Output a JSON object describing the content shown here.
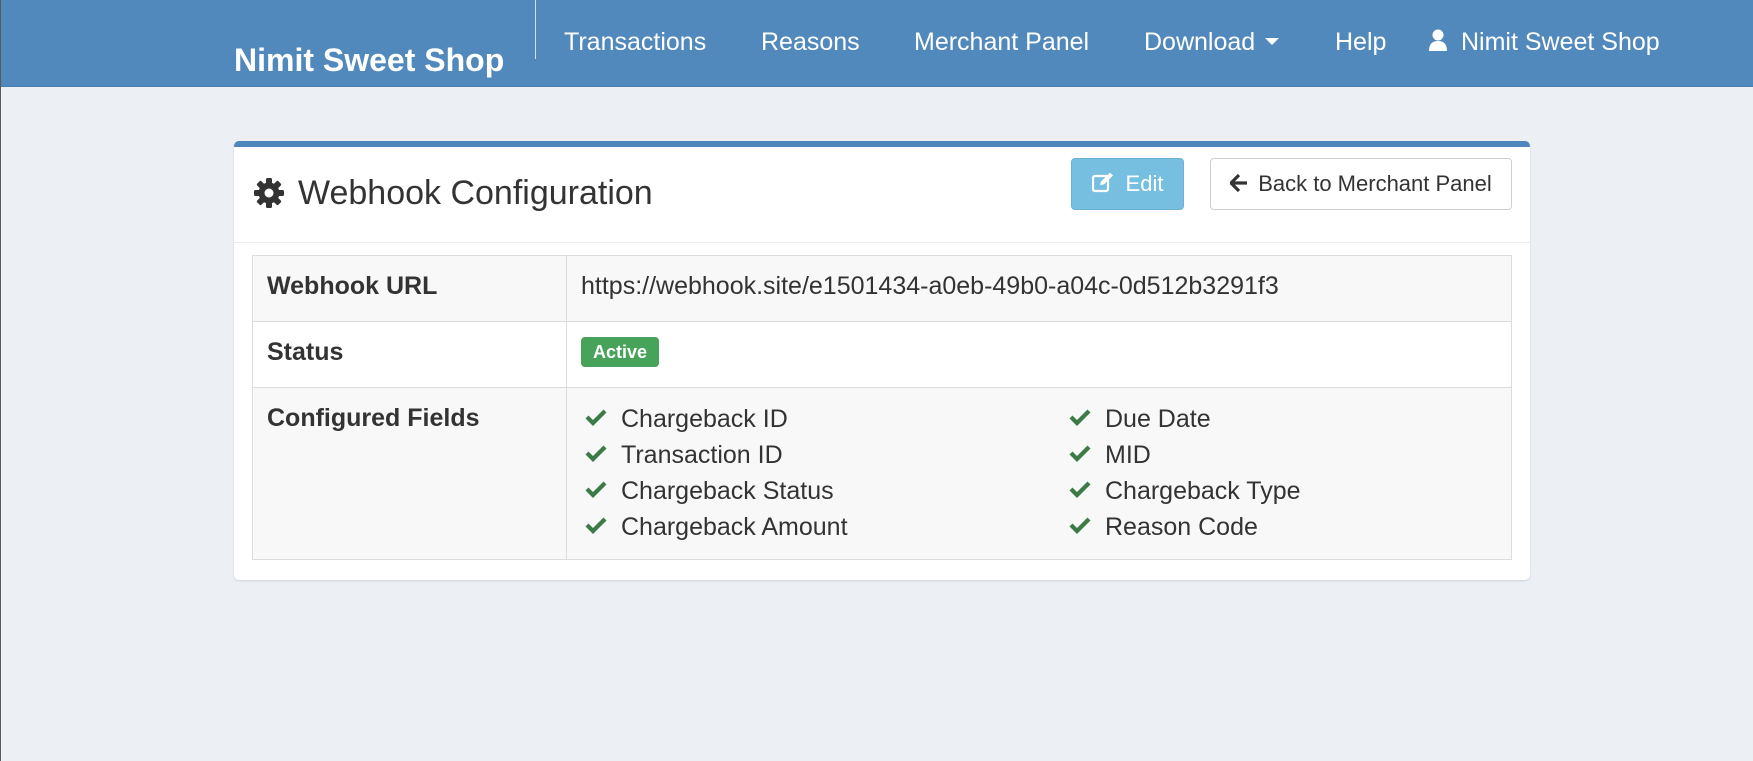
{
  "navbar": {
    "brand": "Nimit Sweet Shop",
    "items": [
      {
        "label": "Transactions"
      },
      {
        "label": "Reasons"
      },
      {
        "label": "Merchant Panel"
      },
      {
        "label": "Download"
      },
      {
        "label": "Help"
      }
    ],
    "user_label": "Nimit Sweet Shop",
    "download_icon": "caret-down-icon",
    "user_icon": "user-icon"
  },
  "panel": {
    "title": "Webhook Configuration",
    "title_icon": "gear-icon",
    "edit_label": "Edit",
    "edit_icon": "edit-icon",
    "back_label": "Back to Merchant Panel",
    "back_icon": "arrow-left-icon"
  },
  "table": {
    "url_label": "Webhook URL",
    "url_value": "https://webhook.site/e1501434-a0eb-49b0-a04c-0d512b3291f3",
    "status_label": "Status",
    "status_value": "Active",
    "fields_label": "Configured Fields",
    "fields": [
      "Chargeback ID",
      "Due Date",
      "Transaction ID",
      "MID",
      "Chargeback Status",
      "Chargeback Type",
      "Chargeback Amount",
      "Reason Code"
    ]
  },
  "colors": {
    "navbar": "#5289bc",
    "panel_accent": "#4e86bd",
    "edit_button": "#76bfe0",
    "status_badge": "#48a35a",
    "check": "#3c7a46",
    "background": "#ecf0f5"
  }
}
